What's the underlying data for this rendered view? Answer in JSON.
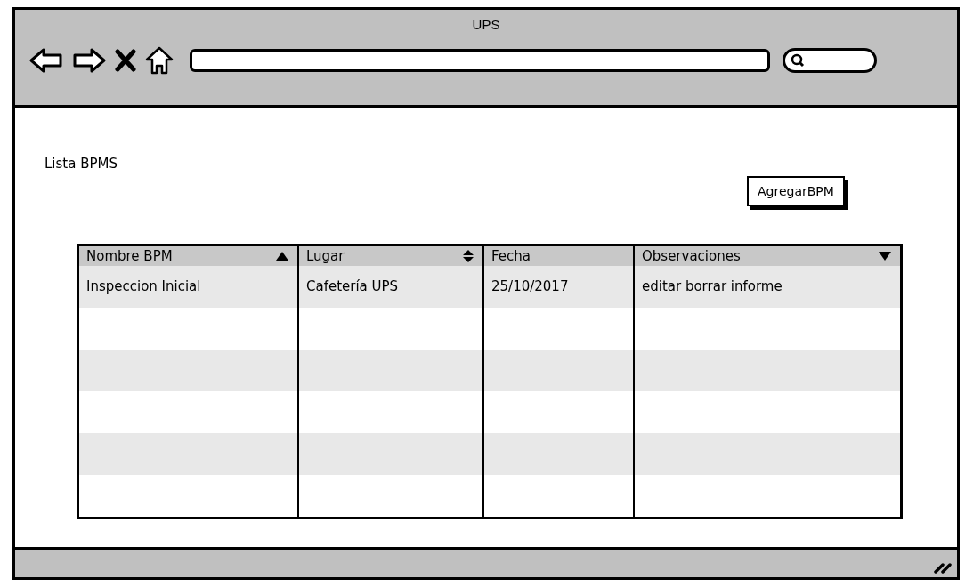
{
  "window": {
    "title": "UPS"
  },
  "page": {
    "heading": "Lista BPMS",
    "add_button": "AgregarBPM"
  },
  "table": {
    "columns": [
      {
        "label": "Nombre BPM",
        "kind": "ascending"
      },
      {
        "label": "Lugar",
        "kind": "sortable"
      },
      {
        "label": "Fecha",
        "kind": "plain"
      },
      {
        "label": "Observaciones",
        "kind": "descending"
      }
    ],
    "rows": [
      [
        "Inspeccion Inicial",
        "Cafetería UPS",
        "25/10/2017",
        "editar borrar informe"
      ]
    ]
  }
}
